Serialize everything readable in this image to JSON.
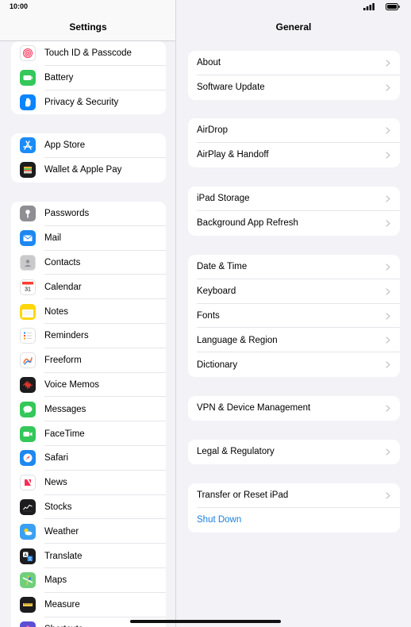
{
  "status_bar": {
    "time": "10:00"
  },
  "sidebar": {
    "title": "Settings",
    "groups": [
      {
        "items": [
          {
            "label": "Touch ID & Passcode",
            "icon": "fingerprint-icon",
            "color": "#ffffff"
          },
          {
            "label": "Battery",
            "icon": "battery-icon",
            "color": "#34c759"
          },
          {
            "label": "Privacy & Security",
            "icon": "hand-icon",
            "color": "#0a84ff"
          }
        ]
      },
      {
        "items": [
          {
            "label": "App Store",
            "icon": "app-store-icon",
            "color": "#1b8cf7"
          },
          {
            "label": "Wallet & Apple Pay",
            "icon": "wallet-icon",
            "color": "#1c1c1e"
          }
        ]
      },
      {
        "items": [
          {
            "label": "Passwords",
            "icon": "key-icon",
            "color": "#8e8e93"
          },
          {
            "label": "Mail",
            "icon": "mail-icon",
            "color": "#1e88f0"
          },
          {
            "label": "Contacts",
            "icon": "contacts-icon",
            "color": "#c9c9cc"
          },
          {
            "label": "Calendar",
            "icon": "calendar-icon",
            "color": "#ffffff"
          },
          {
            "label": "Notes",
            "icon": "notes-icon",
            "color": "#ffd60a"
          },
          {
            "label": "Reminders",
            "icon": "reminders-icon",
            "color": "#ffffff"
          },
          {
            "label": "Freeform",
            "icon": "freeform-icon",
            "color": "#ffffff"
          },
          {
            "label": "Voice Memos",
            "icon": "voice-memos-icon",
            "color": "#1c1c1e"
          },
          {
            "label": "Messages",
            "icon": "messages-icon",
            "color": "#34c759"
          },
          {
            "label": "FaceTime",
            "icon": "facetime-icon",
            "color": "#34c759"
          },
          {
            "label": "Safari",
            "icon": "safari-icon",
            "color": "#1e88f0"
          },
          {
            "label": "News",
            "icon": "news-icon",
            "color": "#ffffff"
          },
          {
            "label": "Stocks",
            "icon": "stocks-icon",
            "color": "#1c1c1e"
          },
          {
            "label": "Weather",
            "icon": "weather-icon",
            "color": "#3aa0f3"
          },
          {
            "label": "Translate",
            "icon": "translate-icon",
            "color": "#1c1c1e"
          },
          {
            "label": "Maps",
            "icon": "maps-icon",
            "color": "#6fcf7a"
          },
          {
            "label": "Measure",
            "icon": "measure-icon",
            "color": "#1c1c1e"
          },
          {
            "label": "Shortcuts",
            "icon": "shortcuts-icon",
            "color": "#5b4fd6"
          }
        ]
      }
    ]
  },
  "detail": {
    "title": "General",
    "groups": [
      {
        "rows": [
          {
            "label": "About"
          },
          {
            "label": "Software Update"
          }
        ]
      },
      {
        "rows": [
          {
            "label": "AirDrop"
          },
          {
            "label": "AirPlay & Handoff"
          }
        ]
      },
      {
        "rows": [
          {
            "label": "iPad Storage"
          },
          {
            "label": "Background App Refresh"
          }
        ]
      },
      {
        "rows": [
          {
            "label": "Date & Time"
          },
          {
            "label": "Keyboard"
          },
          {
            "label": "Fonts"
          },
          {
            "label": "Language & Region"
          },
          {
            "label": "Dictionary"
          }
        ]
      },
      {
        "rows": [
          {
            "label": "VPN & Device Management"
          }
        ]
      },
      {
        "rows": [
          {
            "label": "Legal & Regulatory"
          }
        ]
      },
      {
        "rows": [
          {
            "label": "Transfer or Reset iPad"
          },
          {
            "label": "Shut Down",
            "style": "link"
          }
        ]
      }
    ]
  },
  "colors": {
    "link": "#1a7fe0",
    "background": "#f2f2f7"
  }
}
